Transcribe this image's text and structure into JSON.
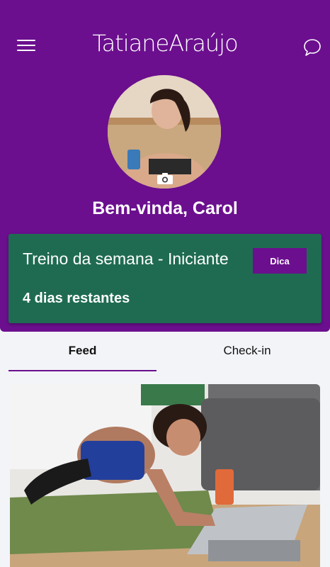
{
  "header": {
    "logo_text": "TatianeAraújo"
  },
  "profile": {
    "greeting": "Bem-vinda, Carol"
  },
  "workout_card": {
    "title": "Treino da semana - Iniciante",
    "remaining": "4 dias restantes",
    "tip_button": "Dica"
  },
  "tabs": [
    {
      "label": "Feed",
      "active": true
    },
    {
      "label": "Check-in",
      "active": false
    }
  ],
  "colors": {
    "brand_purple": "#6b0f8e",
    "card_green": "#1f6b52",
    "background": "#f3f4f8"
  },
  "icons": {
    "menu": "hamburger-menu-icon",
    "chat": "chat-bubble-icon",
    "camera": "camera-icon"
  }
}
